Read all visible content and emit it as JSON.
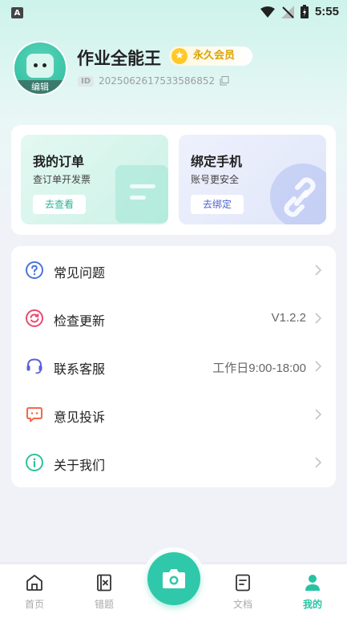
{
  "status_bar": {
    "time": "5:55",
    "left_icon": "A"
  },
  "profile": {
    "avatar_edit_label": "编辑",
    "username": "作业全能王",
    "vip_label": "永久会员",
    "id_tag": "ID",
    "id_value": "2025062617533586852"
  },
  "cards": [
    {
      "title": "我的订单",
      "subtitle": "查订单开发票",
      "button": "去查看"
    },
    {
      "title": "绑定手机",
      "subtitle": "账号更安全",
      "button": "去绑定"
    }
  ],
  "menu": [
    {
      "label": "常见问题",
      "value": "",
      "icon": "question-icon",
      "color": "#4a74d9"
    },
    {
      "label": "检查更新",
      "value": "V1.2.2",
      "icon": "refresh-icon",
      "color": "#e84a6f"
    },
    {
      "label": "联系客服",
      "value": "工作日9:00-18:00",
      "icon": "headset-icon",
      "color": "#5b5fdb"
    },
    {
      "label": "意见投诉",
      "value": "",
      "icon": "chat-icon",
      "color": "#ef6a4a"
    },
    {
      "label": "关于我们",
      "value": "",
      "icon": "info-icon",
      "color": "#2fc19b"
    }
  ],
  "nav": [
    {
      "label": "首页",
      "icon": "home-icon",
      "active": false
    },
    {
      "label": "错题",
      "icon": "wrong-book-icon",
      "active": false
    },
    {
      "label": "",
      "icon": "camera-icon",
      "active": false
    },
    {
      "label": "文档",
      "icon": "document-icon",
      "active": false
    },
    {
      "label": "我的",
      "icon": "user-icon",
      "active": true
    }
  ],
  "colors": {
    "accent": "#30c8aa",
    "vip": "#ffc928"
  }
}
